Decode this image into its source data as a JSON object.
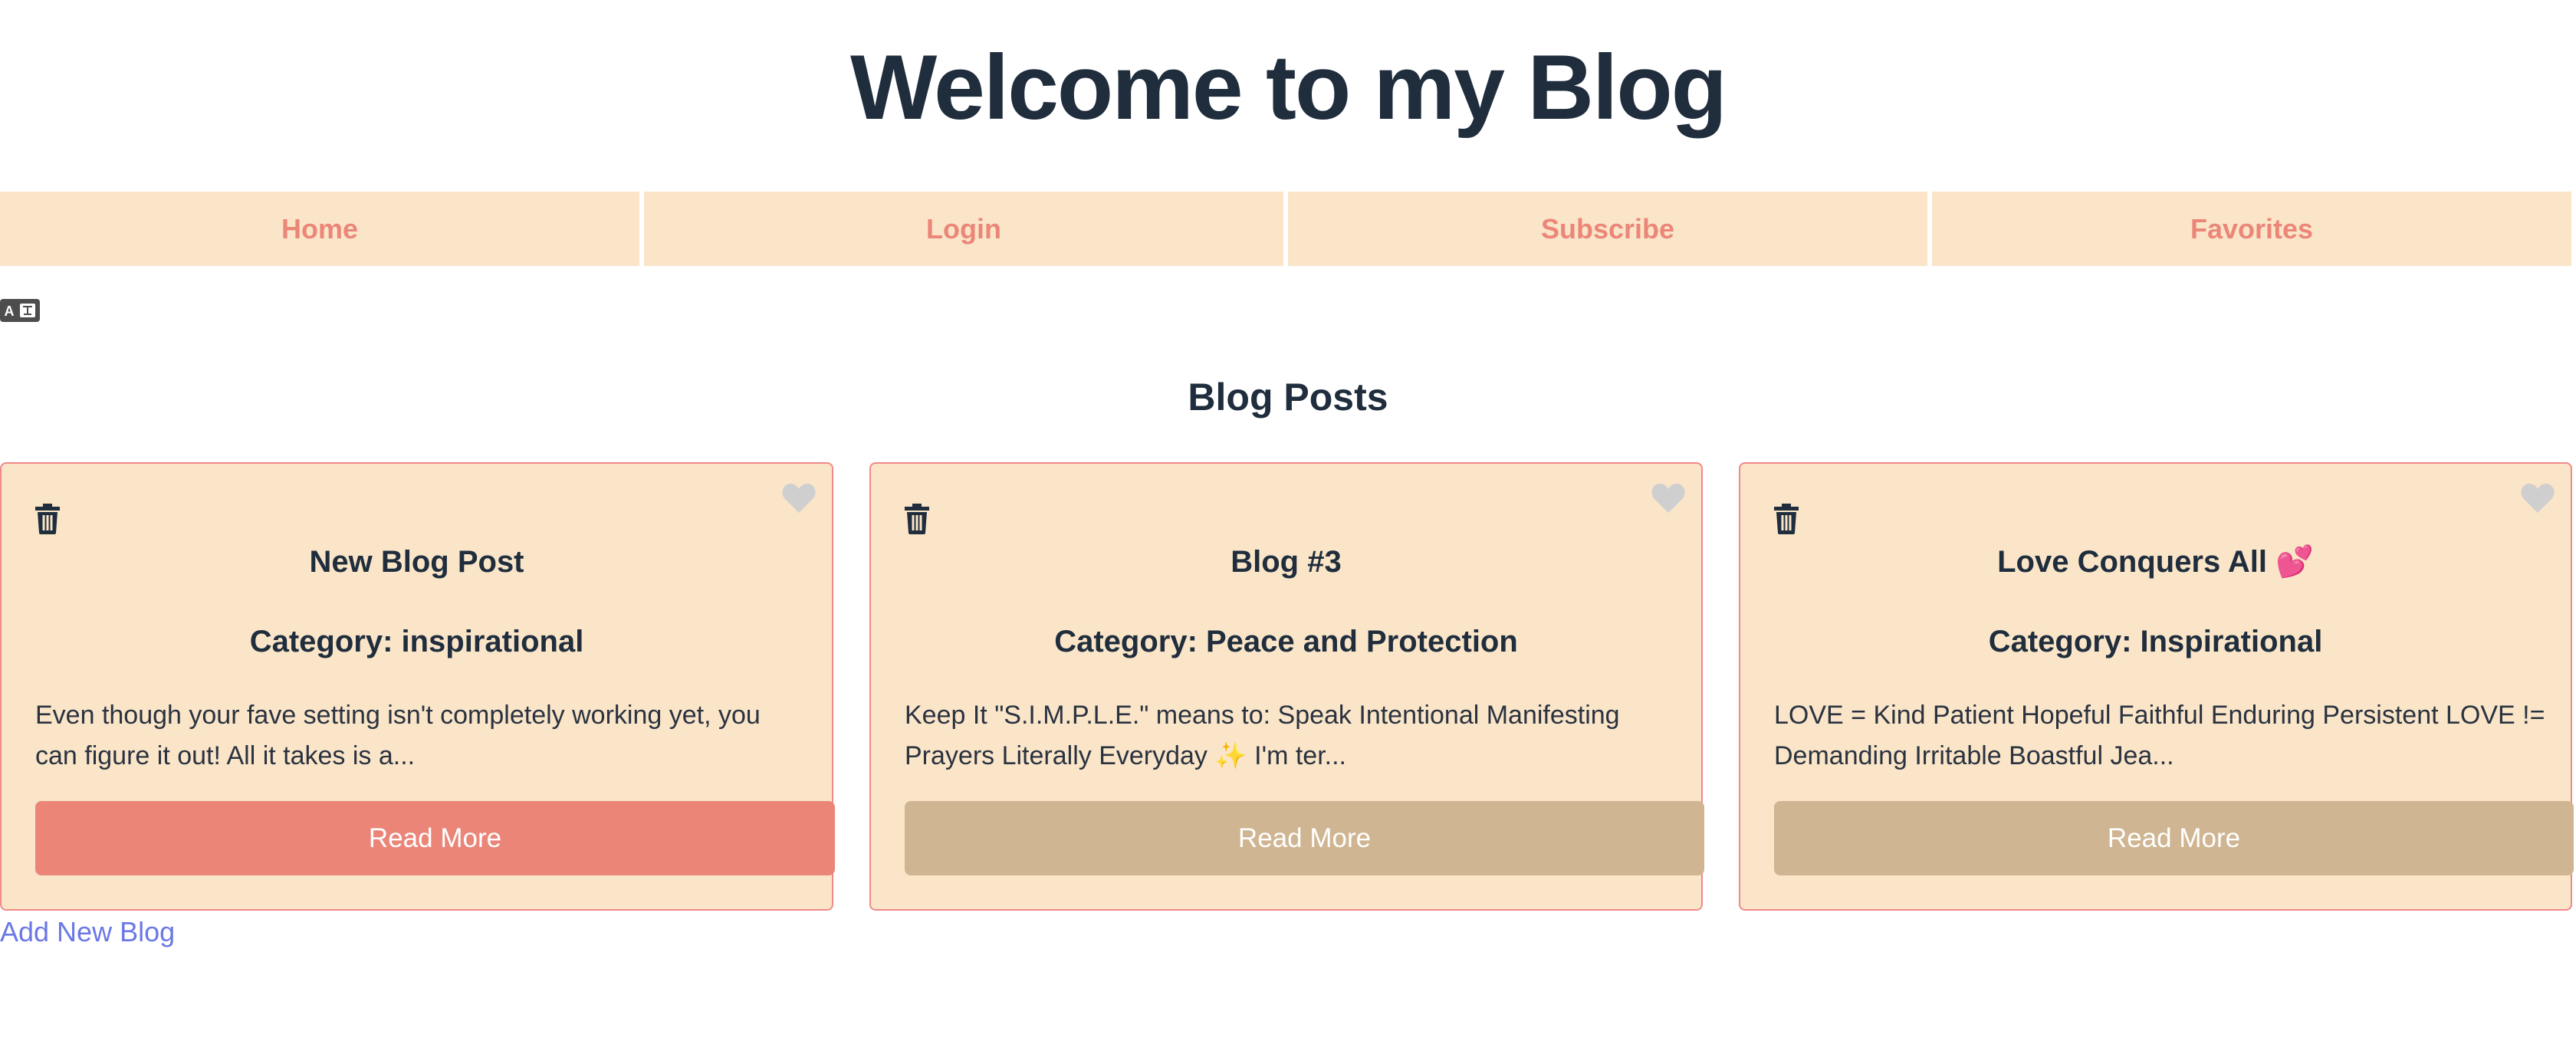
{
  "header": {
    "title": "Welcome to my Blog"
  },
  "nav": {
    "items": [
      {
        "label": "Home"
      },
      {
        "label": "Login"
      },
      {
        "label": "Subscribe"
      },
      {
        "label": "Favorites"
      }
    ]
  },
  "translate_icon": "translate-icon",
  "section": {
    "title": "Blog Posts"
  },
  "posts": [
    {
      "title": "New Blog Post",
      "category": "Category: inspirational",
      "excerpt": "Even though your fave setting isn't completely working yet, you can figure it out! All it takes is a...",
      "read_more": "Read More",
      "button_color": "#ea8578"
    },
    {
      "title": "Blog #3",
      "category": "Category: Peace and Protection",
      "excerpt": "Keep It \"S.I.M.P.L.E.\" means to: Speak Intentional Manifesting Prayers Literally Everyday ✨ I'm ter...",
      "read_more": "Read More",
      "button_color": "#cfb591"
    },
    {
      "title": "Love Conquers All 💕",
      "category": "Category: Inspirational",
      "excerpt": "LOVE = Kind Patient Hopeful Faithful Enduring Persistent LOVE != Demanding Irritable Boastful Jea...",
      "read_more": "Read More",
      "button_color": "#cfb591"
    }
  ],
  "footer": {
    "add_link": "Add New Blog"
  },
  "colors": {
    "text": "#1f2d3d",
    "nav_bg": "#fae5c8",
    "nav_text": "#eb8678",
    "card_bg": "#fae5c8",
    "card_border": "#f08a8a",
    "link": "#6b78e5"
  }
}
